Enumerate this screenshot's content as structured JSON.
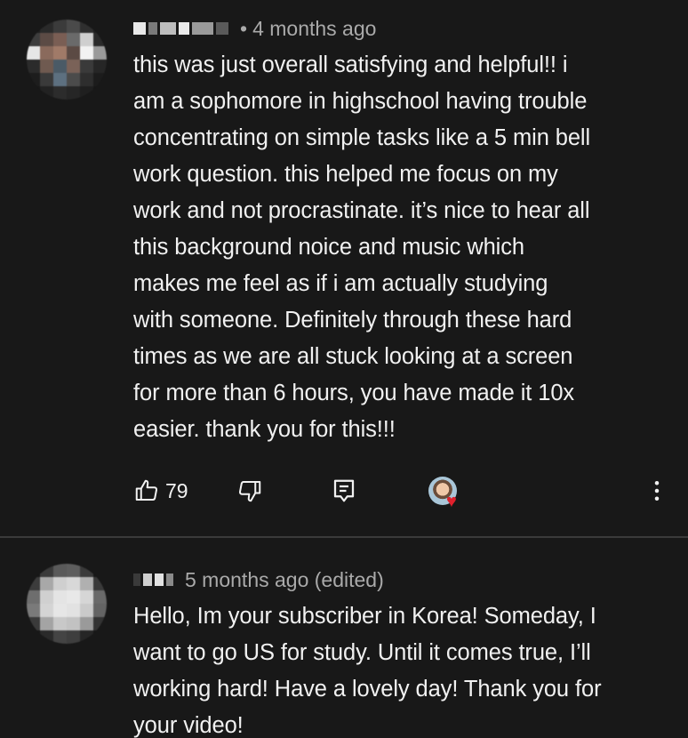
{
  "comments": [
    {
      "timestamp": "4 months ago",
      "text": "this was just overall satisfying and helpful!! i\nam a sophomore in highschool having trouble\nconcentrating on simple tasks like a 5 min bell\nwork question. this helped me focus on my\nwork and not procrastinate. it’s nice to hear all\nthis background noice and music which\nmakes me feel as if i am actually studying\nwith someone. Definitely through these hard\ntimes as we are all stuck looking at a screen\nfor more than 6 hours, you have made it 10x\neasier. thank you for this!!!",
      "likes": "79",
      "icons": {
        "like": "thumbs-up-icon",
        "dislike": "thumbs-down-icon",
        "reply": "reply-icon",
        "creator_heart": "creator-heart-icon",
        "more": "more-vertical-icon"
      }
    },
    {
      "timestamp": "5 months ago (edited)",
      "text": "Hello, Im your subscriber in Korea! Someday, I\nwant to go US for study. Until it comes true, I’ll\nworking hard! Have a lovely day! Thank you for\nyour video!"
    }
  ],
  "colors": {
    "background": "#181818",
    "text": "#f1f1f1",
    "meta": "#aaaaaa",
    "divider": "#3a3a3a",
    "heart": "#e0202c"
  },
  "separator": "•"
}
